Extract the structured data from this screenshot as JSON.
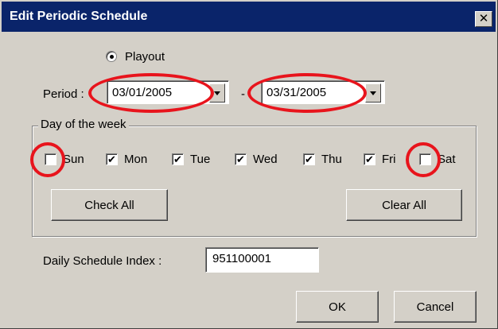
{
  "window": {
    "title": "Edit Periodic Schedule",
    "close_glyph": "✕",
    "close_icon": "close-icon"
  },
  "mode": {
    "label": "Playout",
    "selected": true
  },
  "period": {
    "label": "Period :",
    "start": "03/01/2005",
    "separator": "-",
    "end": "03/31/2005"
  },
  "days_group": {
    "label": "Day of the week",
    "days": [
      {
        "label": "Sun",
        "checked": false,
        "mark": ""
      },
      {
        "label": "Mon",
        "checked": true,
        "mark": "✔"
      },
      {
        "label": "Tue",
        "checked": true,
        "mark": "✔"
      },
      {
        "label": "Wed",
        "checked": true,
        "mark": "✔"
      },
      {
        "label": "Thu",
        "checked": true,
        "mark": "✔"
      },
      {
        "label": "Fri",
        "checked": true,
        "mark": "✔"
      },
      {
        "label": "Sat",
        "checked": false,
        "mark": ""
      }
    ],
    "check_all_label": "Check All",
    "clear_all_label": "Clear All"
  },
  "daily_index": {
    "label": "Daily Schedule Index :",
    "value": "951100001"
  },
  "buttons": {
    "ok": "OK",
    "cancel": "Cancel"
  },
  "annotations": {
    "highlight_color": "#e8141c"
  }
}
